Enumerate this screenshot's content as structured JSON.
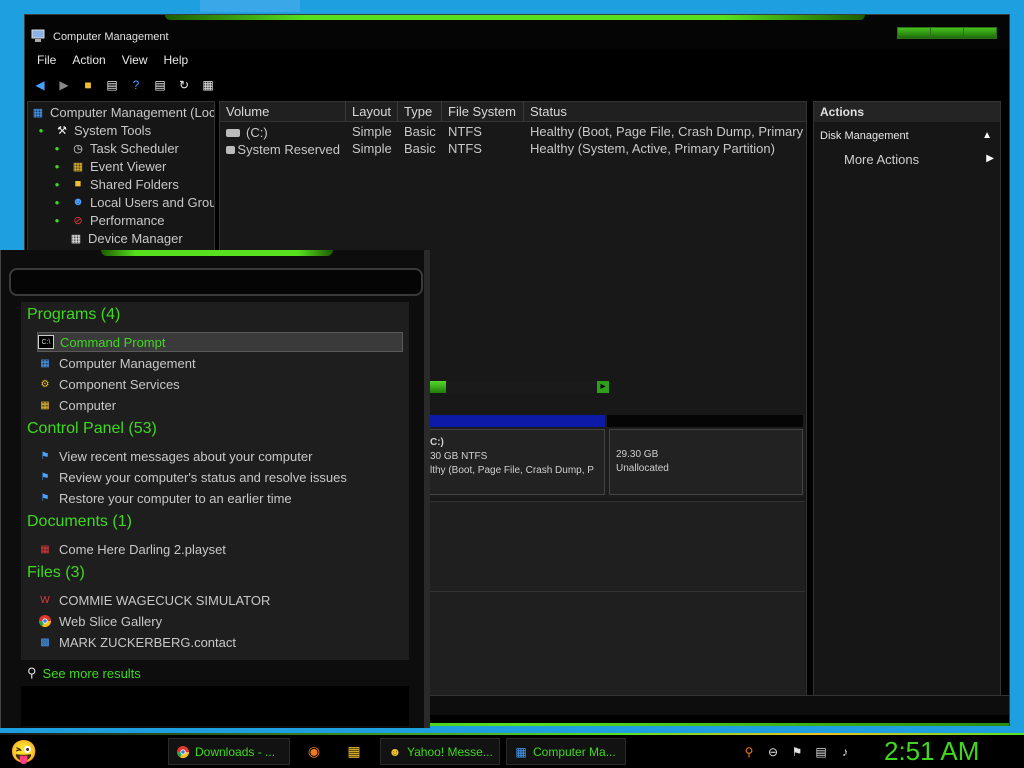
{
  "window": {
    "title": "Computer Management",
    "menu": [
      "File",
      "Action",
      "View",
      "Help"
    ]
  },
  "tree": {
    "root": "Computer Management (Loc",
    "system_tools": "System Tools",
    "items": [
      "Task Scheduler",
      "Event Viewer",
      "Shared Folders",
      "Local Users and Grou",
      "Performance",
      "Device Manager"
    ]
  },
  "volumes": {
    "columns": [
      "Volume",
      "Layout",
      "Type",
      "File System",
      "Status"
    ],
    "rows": [
      {
        "volume": "(C:)",
        "layout": "Simple",
        "type": "Basic",
        "fs": "NTFS",
        "status": "Healthy (Boot, Page File, Crash Dump, Primary"
      },
      {
        "volume": "System Reserved",
        "layout": "Simple",
        "type": "Basic",
        "fs": "NTFS",
        "status": "Healthy (System, Active, Primary Partition)"
      }
    ]
  },
  "disk_graph": {
    "c_label": "C:)",
    "c_size": "30 GB NTFS",
    "c_status": "lthy (Boot, Page File, Crash Dump, P",
    "u_size": "29.30 GB",
    "u_label": "Unallocated"
  },
  "scrollbar": {
    "thumb_fraction": 0.33
  },
  "actions": {
    "header": "Actions",
    "section": "Disk Management",
    "more": "More Actions"
  },
  "start_menu": {
    "programs_head": "Programs (4)",
    "programs": [
      "Command Prompt",
      "Computer Management",
      "Component Services",
      "Computer"
    ],
    "control_head": "Control Panel (53)",
    "control": [
      "View recent messages about your computer",
      "Review your computer's status and resolve issues",
      "Restore your computer to an earlier time"
    ],
    "documents_head": "Documents (1)",
    "documents": [
      "Come Here Darling 2.playset"
    ],
    "files_head": "Files (3)",
    "files": [
      "COMMIE WAGECUCK SIMULATOR",
      "Web Slice Gallery",
      "MARK ZUCKERBERG.contact"
    ],
    "see_more": "See more results"
  },
  "taskbar": {
    "downloads": "Downloads - ...",
    "yahoo": "Yahoo! Messe...",
    "compmgmt": "Computer Ma...",
    "clock": "2:51 AM"
  },
  "colors": {
    "accent_green": "#3fd81f",
    "window_bg": "#000000",
    "desktop_blue": "#1e9fe0"
  }
}
